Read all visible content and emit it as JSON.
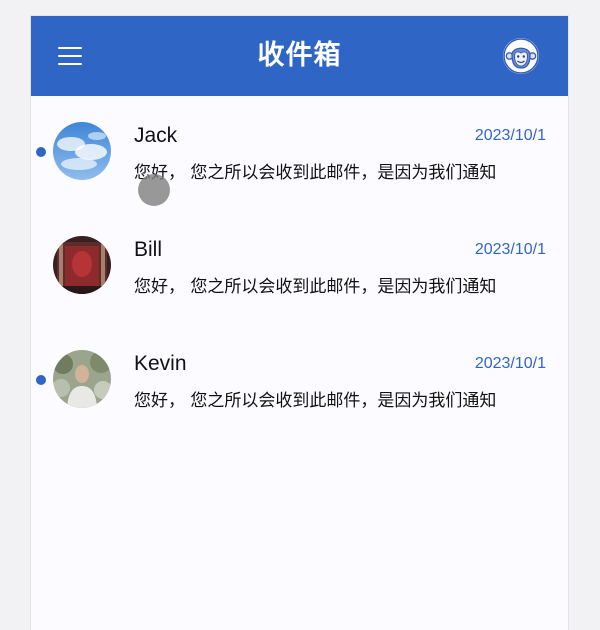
{
  "header": {
    "title": "收件箱",
    "menu_icon": "hamburger-menu-icon",
    "avatar_icon": "monkey-avatar-icon",
    "background_color": "#2f66c6"
  },
  "emails": [
    {
      "sender": "Jack",
      "date": "2023/10/1",
      "preview": "您好， 您之所以会收到此邮件，是因为我们通知",
      "unread": true,
      "avatar": "sky-clouds-avatar"
    },
    {
      "sender": "Bill",
      "date": "2023/10/1",
      "preview": "您好， 您之所以会收到此邮件，是因为我们通知",
      "unread": false,
      "avatar": "red-portrait-avatar"
    },
    {
      "sender": "Kevin",
      "date": "2023/10/1",
      "preview": "您好， 您之所以会收到此邮件，是因为我们通知",
      "unread": true,
      "avatar": "outdoor-person-avatar"
    }
  ],
  "colors": {
    "accent": "#2f66c6",
    "unread_dot": "#2f66c6",
    "date_text": "#2f66c6"
  }
}
